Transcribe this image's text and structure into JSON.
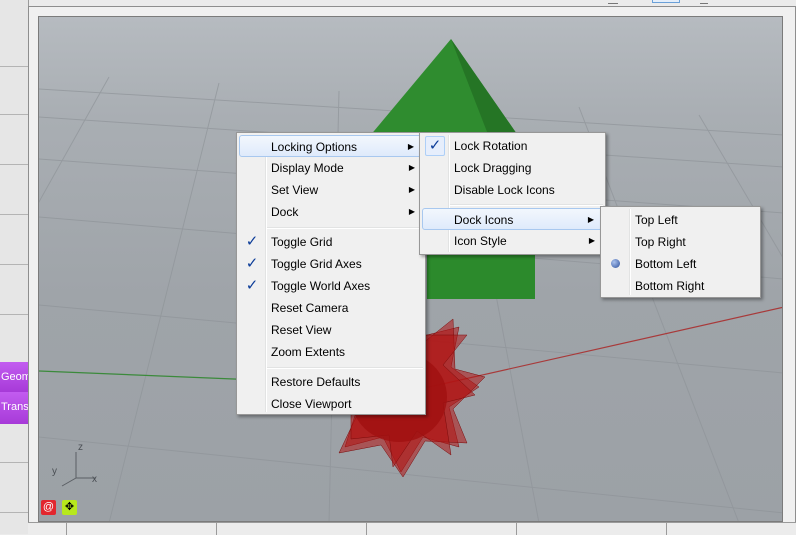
{
  "canvas": {
    "nodes": [
      {
        "label": "Geom"
      },
      {
        "label": "Trans"
      }
    ]
  },
  "viewport": {
    "axis_labels": {
      "x": "x",
      "y": "y",
      "z": "z"
    },
    "corner_icons": [
      "lock-rotation-icon",
      "lock-dragging-icon"
    ]
  },
  "context_menu": {
    "items": [
      {
        "label": "Locking Options",
        "submenu": true,
        "highlighted": true
      },
      {
        "label": "Display Mode",
        "submenu": true
      },
      {
        "label": "Set View",
        "submenu": true
      },
      {
        "label": "Dock",
        "submenu": true
      },
      {
        "label": "Toggle Grid",
        "checked": true
      },
      {
        "label": "Toggle Grid Axes",
        "checked": true
      },
      {
        "label": "Toggle World Axes",
        "checked": true
      },
      {
        "label": "Reset Camera"
      },
      {
        "label": "Reset View"
      },
      {
        "label": "Zoom Extents"
      },
      {
        "label": "Restore Defaults"
      },
      {
        "label": "Close Viewport"
      }
    ]
  },
  "locking_menu": {
    "items": [
      {
        "label": "Lock Rotation",
        "checked": true
      },
      {
        "label": "Lock Dragging"
      },
      {
        "label": "Disable Lock Icons"
      },
      {
        "label": "Dock Icons",
        "submenu": true,
        "highlighted": true
      },
      {
        "label": "Icon Style",
        "submenu": true
      }
    ]
  },
  "dock_icons_menu": {
    "items": [
      {
        "label": "Top Left"
      },
      {
        "label": "Top Right"
      },
      {
        "label": "Bottom Left",
        "selected": true
      },
      {
        "label": "Bottom Right"
      }
    ]
  },
  "colors": {
    "cone": "#3a9a3a",
    "star": "#b01515",
    "highlight_border": "#a8c8ef",
    "check": "#0d3d99",
    "node_purple": "#b04ae0"
  }
}
